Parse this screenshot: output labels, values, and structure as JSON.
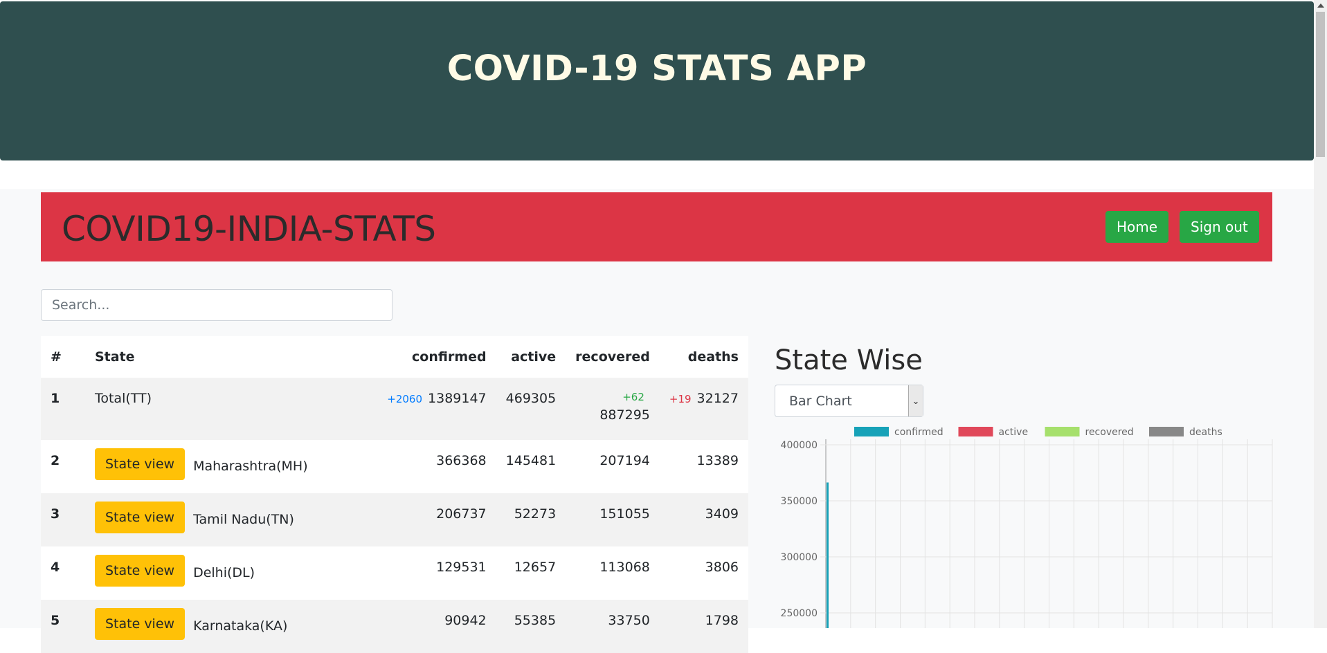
{
  "header": {
    "title": "COVID-19 STATS APP"
  },
  "navbar": {
    "brand": "COVID19-INDIA-STATS",
    "home_label": "Home",
    "signout_label": "Sign out",
    "bg_color": "#dc3545"
  },
  "search": {
    "placeholder": "Search...",
    "value": ""
  },
  "table": {
    "headers": [
      "#",
      "State",
      "confirmed",
      "active",
      "recovered",
      "deaths"
    ],
    "state_view_label": "State view",
    "rows": [
      {
        "num": "1",
        "state": "Total(TT)",
        "confirmed": "1389147",
        "confirmed_delta": "+2060",
        "active": "469305",
        "recovered": "887295",
        "recovered_delta": "+62",
        "deaths": "32127",
        "deaths_delta": "+19"
      },
      {
        "num": "2",
        "state": "Maharashtra(MH)",
        "confirmed": "366368",
        "active": "145481",
        "recovered": "207194",
        "deaths": "13389"
      },
      {
        "num": "3",
        "state": "Tamil Nadu(TN)",
        "confirmed": "206737",
        "active": "52273",
        "recovered": "151055",
        "deaths": "3409"
      },
      {
        "num": "4",
        "state": "Delhi(DL)",
        "confirmed": "129531",
        "active": "12657",
        "recovered": "113068",
        "deaths": "3806"
      },
      {
        "num": "5",
        "state": "Karnataka(KA)",
        "confirmed": "90942",
        "active": "55385",
        "recovered": "33750",
        "deaths": "1798"
      }
    ]
  },
  "panel": {
    "title": "State Wise",
    "chart_type_selected": "Bar Chart"
  },
  "chart_data": {
    "type": "bar",
    "legend": [
      {
        "name": "confirmed",
        "color": "#17a2b8"
      },
      {
        "name": "active",
        "color": "#e0485a"
      },
      {
        "name": "recovered",
        "color": "#a6e06c"
      },
      {
        "name": "deaths",
        "color": "#888888"
      }
    ],
    "yticks": [
      "400000",
      "350000",
      "300000",
      "250000"
    ],
    "ylim_visible": [
      245000,
      400000
    ],
    "series": [
      {
        "name": "confirmed",
        "values": [
          366368
        ]
      }
    ]
  }
}
